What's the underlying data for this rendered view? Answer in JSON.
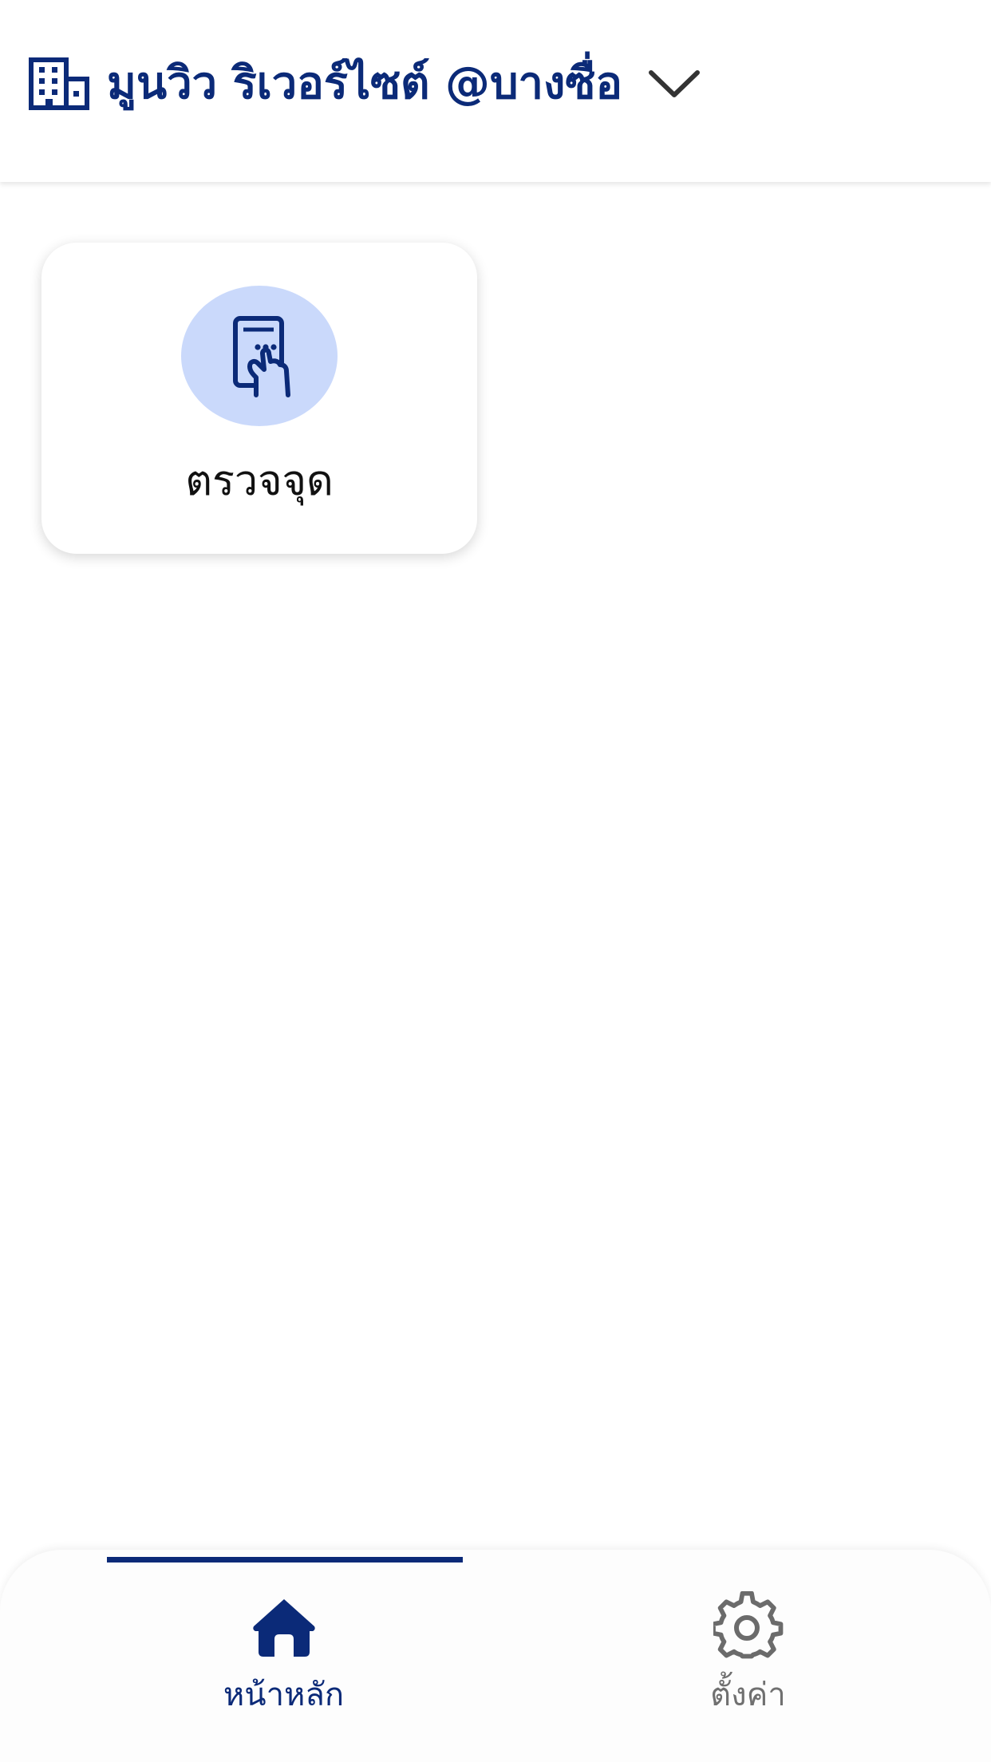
{
  "header": {
    "project_name": "มูนวิว ริเวอร์ไซต์ @บางซื่อ",
    "building_icon": "building-icon",
    "dropdown_icon": "chevron-down-icon"
  },
  "menu": {
    "items": [
      {
        "label": "ตรวจจุด",
        "icon": "tablet-touch-icon"
      }
    ]
  },
  "bottom_nav": {
    "tabs": [
      {
        "label": "หน้าหลัก",
        "icon": "home-icon",
        "active": true
      },
      {
        "label": "ตั้งค่า",
        "icon": "gear-icon",
        "active": false
      }
    ]
  },
  "colors": {
    "brand": "#0b2a78",
    "icon_circle": "#cad9fb",
    "inactive": "#707070",
    "text": "#111111"
  }
}
